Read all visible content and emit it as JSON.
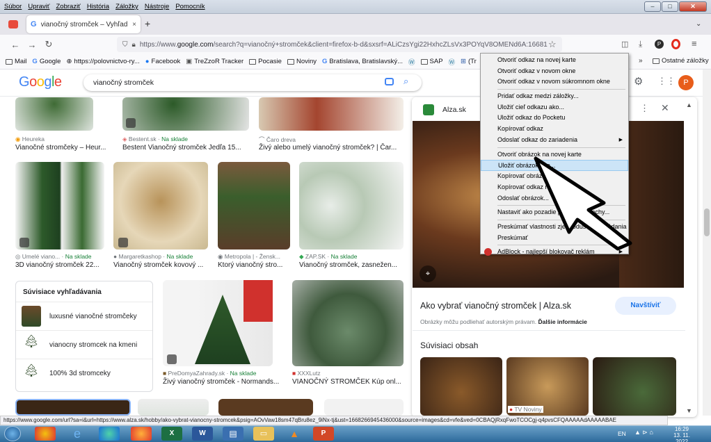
{
  "menubar": {
    "items": [
      "Súbor",
      "Upraviť",
      "Zobraziť",
      "História",
      "Záložky",
      "Nástroje",
      "Pomocník"
    ]
  },
  "tab": {
    "title": "vianočný stromček – Vyhľadáva",
    "close": "×",
    "new": "+"
  },
  "url": {
    "prefix": "https://www.",
    "host": "google.com",
    "rest": "/search?q=vianočný+stromček&client=firefox-b-d&sxsrf=ALiCzsYgi22HxhcZLsVx3POYqV8OMENd6A:16681"
  },
  "bookmarks": [
    "Mail",
    "Google",
    "https://polovnictvo-ry...",
    "Facebook",
    "TreZzoR Tracker",
    "Pocasie",
    "Noviny",
    "Bratislava, Bratislavský...",
    "SAP",
    "(Tr",
    "Ostatné záložky"
  ],
  "google": {
    "query": "vianočný stromček",
    "avatar": "P"
  },
  "results": [
    {
      "source": "Heureka",
      "stock": "",
      "title": "Vianočné stromčeky – Heur..."
    },
    {
      "source": "Bestent.sk",
      "stock": "Na sklade",
      "title": "Bestent Vianočný stromček Jedľa 15..."
    },
    {
      "source": "Čaro dreva",
      "stock": "",
      "title": "Živý alebo umelý vianočný stromček? | Čar..."
    },
    {
      "source": "Umelé viano...",
      "stock": "Na sklade",
      "title": "3D vianočný stromček 22..."
    },
    {
      "source": "Margaretkashop",
      "stock": "Na sklade",
      "title": "Vianočný stromček kovový ..."
    },
    {
      "source": "Metropola | - Žensk...",
      "stock": "",
      "title": "Ktorý vianočný stro..."
    },
    {
      "source": "ZAP.SK",
      "stock": "Na sklade",
      "title": "Vianočný stromček, zasnežen..."
    },
    {
      "source": "PreDomyaZahrady.sk",
      "stock": "Na sklade",
      "title": "Živý vianočný stromček - Normands..."
    },
    {
      "source": "XXXLutz",
      "stock": "",
      "title": "VIANOČNÝ STROMČEK Kúp onl..."
    }
  ],
  "related": {
    "title": "Súvisiace vyhľadávania",
    "items": [
      "luxusné vianočné stromčeky",
      "vianocny stromcek na kmeni",
      "100% 3d stromceky"
    ]
  },
  "panel": {
    "site": "Alza.sk",
    "title": "Ako vybrať vianočný stromček | Alza.sk",
    "visit": "Navštíviť",
    "copyright": "Obrázky môžu podliehať autorským právam.",
    "more_info": "Ďalšie informácie",
    "related_content": "Súvisiaci obsah",
    "tv_source": "TV Noviny"
  },
  "context_menu": {
    "items": [
      "Otvoriť odkaz na novej karte",
      "Otvoriť odkaz v novom okne",
      "Otvoriť odkaz v novom súkromnom okne",
      "---",
      "Pridať odkaz medzi záložky...",
      "Uložiť cieľ odkazu ako...",
      "Uložiť odkaz do Pocketu",
      "Kopírovať odkaz",
      "Odoslať odkaz do zariadenia",
      "---",
      "Otvoriť obrázok na novej karte",
      "Uložiť obrázok ako...",
      "Kopírovať obrázok",
      "Kopírovať odkaz na obrázok",
      "Odoslať obrázok...",
      "---",
      "Nastaviť ako pozadie pracovnej plochy...",
      "---",
      "Preskúmať vlastnosti zjednodušenia ovládania",
      "Preskúmať",
      "---",
      "AdBlock - najlepší blokovač reklám"
    ],
    "highlighted": "Uložiť obrázok ako..."
  },
  "status": "https://www.google.com/url?sa=i&url=https://www.alza.sk/hobby/ako-vybrat-vianocny-stromcek&psig=AOvVaw18sm47qBru8ez_9iNx-tj&ust=1668266945436000&source=images&cd=vfe&ved=0CBAQjRxqFwoTCOCgj-q4pvsCFQAAAAAdAAAAABAE",
  "taskbar": {
    "lang": "EN",
    "time": "16:29",
    "date": "13. 11. 2022"
  },
  "colors": {
    "accent": "#1a73e8",
    "stock": "#188038",
    "google_blue": "#4285f4",
    "google_red": "#ea4335",
    "google_yellow": "#fbbc05",
    "google_green": "#34a853"
  }
}
